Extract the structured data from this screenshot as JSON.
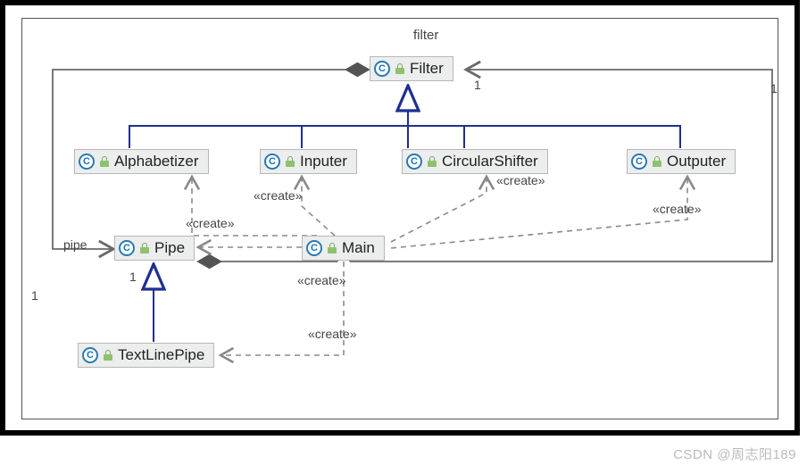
{
  "diagram": {
    "title_top": "filter",
    "classes": {
      "filter": "Filter",
      "alphabetizer": "Alphabetizer",
      "inputer": "Inputer",
      "circularshifter": "CircularShifter",
      "outputer": "Outputer",
      "pipe": "Pipe",
      "main": "Main",
      "textlinepipe": "TextLinePipe"
    },
    "labels": {
      "pipe_role": "pipe",
      "mult_1a": "1",
      "mult_1b": "1",
      "mult_1c": "1",
      "mult_1d": "1",
      "create1": "«create»",
      "create2": "«create»",
      "create3": "«create»",
      "create4": "«create»",
      "create5": "«create»",
      "create6": "«create»"
    },
    "icon_letter": "C"
  },
  "watermark": "CSDN @周志阳189"
}
